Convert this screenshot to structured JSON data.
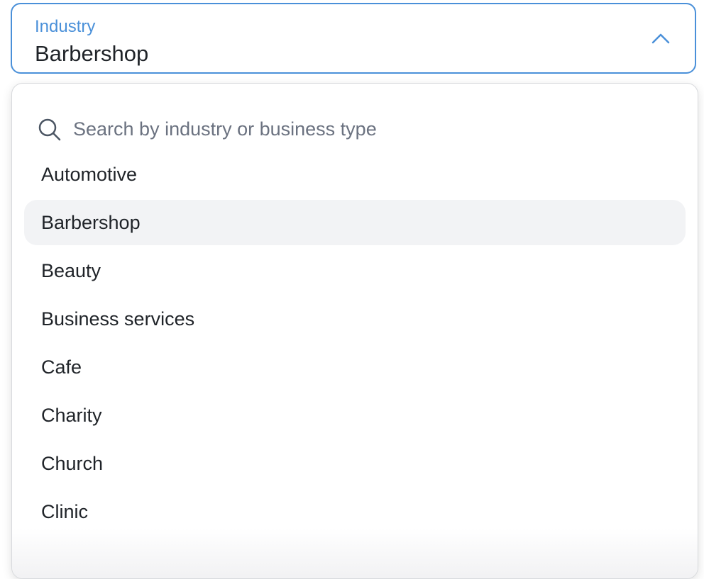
{
  "field": {
    "label": "Industry",
    "value": "Barbershop",
    "accent_color": "#4a90d9",
    "icon": "chevron-up-icon"
  },
  "search": {
    "placeholder": "Search by industry or business type",
    "value": "",
    "icon": "search-icon"
  },
  "options": [
    {
      "label": "Automotive",
      "selected": false
    },
    {
      "label": "Barbershop",
      "selected": true
    },
    {
      "label": "Beauty",
      "selected": false
    },
    {
      "label": "Business services",
      "selected": false
    },
    {
      "label": "Cafe",
      "selected": false
    },
    {
      "label": "Charity",
      "selected": false
    },
    {
      "label": "Church",
      "selected": false
    },
    {
      "label": "Clinic",
      "selected": false
    }
  ]
}
